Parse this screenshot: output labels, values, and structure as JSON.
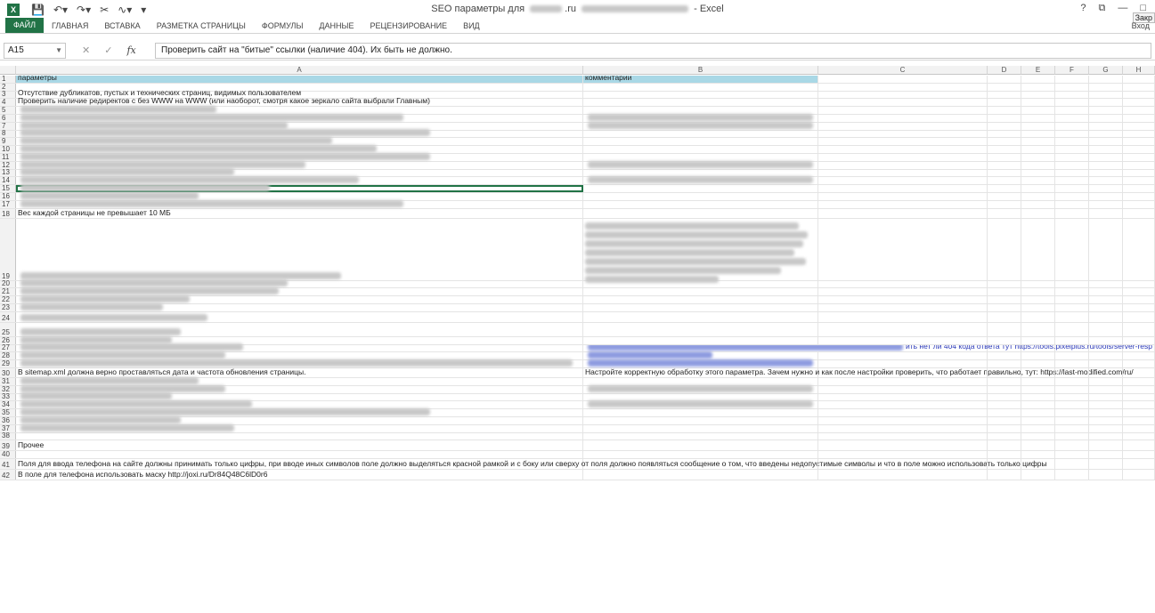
{
  "app": {
    "title_prefix": "SEO параметры для",
    "title_suffix": ".ru",
    "title_app": "- Excel",
    "qat_icons": [
      "save-icon",
      "undo-icon",
      "redo-icon",
      "cut-icon",
      "format-icon",
      "customize-icon"
    ]
  },
  "window": {
    "help": "?",
    "restore": "⧉",
    "minimize": "—",
    "maximize": "□",
    "close_tooltip": "Закр"
  },
  "ribbon": {
    "file_tab": "ФАЙЛ",
    "tabs": [
      "ГЛАВНАЯ",
      "ВСТАВКА",
      "РАЗМЕТКА СТРАНИЦЫ",
      "ФОРМУЛЫ",
      "ДАННЫЕ",
      "РЕЦЕНЗИРОВАНИЕ",
      "ВИД"
    ],
    "login": "Вход"
  },
  "formula_bar": {
    "name_box": "A15",
    "cancel": "✕",
    "enter": "✓",
    "fx": "fx",
    "content": "Проверить сайт на \"битые\" ссылки (наличие 404). Их быть не должно."
  },
  "columns": [
    "A",
    "B",
    "C",
    "D",
    "E",
    "F",
    "G",
    "H"
  ],
  "rows": {
    "r1a": "параметры",
    "r1b": "комментарии",
    "r3a": "Отсутствие дубликатов, пустых и технических страниц, видимых пользователем",
    "r4a": "Проверить наличие редиректов с без WWW на WWW (или наоборот, смотря какое зеркало сайта выбрали Главным)",
    "r18a": "Вес каждой страницы не превышает 10 МБ",
    "r27b_link": "ить нет ли 404 кода ответа тут https://tools.pixelplus.ru/tools/server-resp",
    "r30a": "В sitemap.xml должна верно проставляться дата и частота обновления страницы.",
    "r30b": "Настройте корректную обработку этого параметра. Зачем нужно и как после настройки проверить, что работает правильно, тут: https://last-modified.com/ru/",
    "r39a": "Прочее",
    "r41a": "Поля для ввода телефона на сайте должны принимать только цифры, при вводе иных символов поле должно выделяться красной рамкой и с боку или сверху от поля должно появляться сообщение о том, что введены недопустимые символы и что в поле можно использовать только цифры",
    "r42a": "В поле для телефона использовать маску http://joxi.ru/Dr84Q48C6lD0r6"
  }
}
